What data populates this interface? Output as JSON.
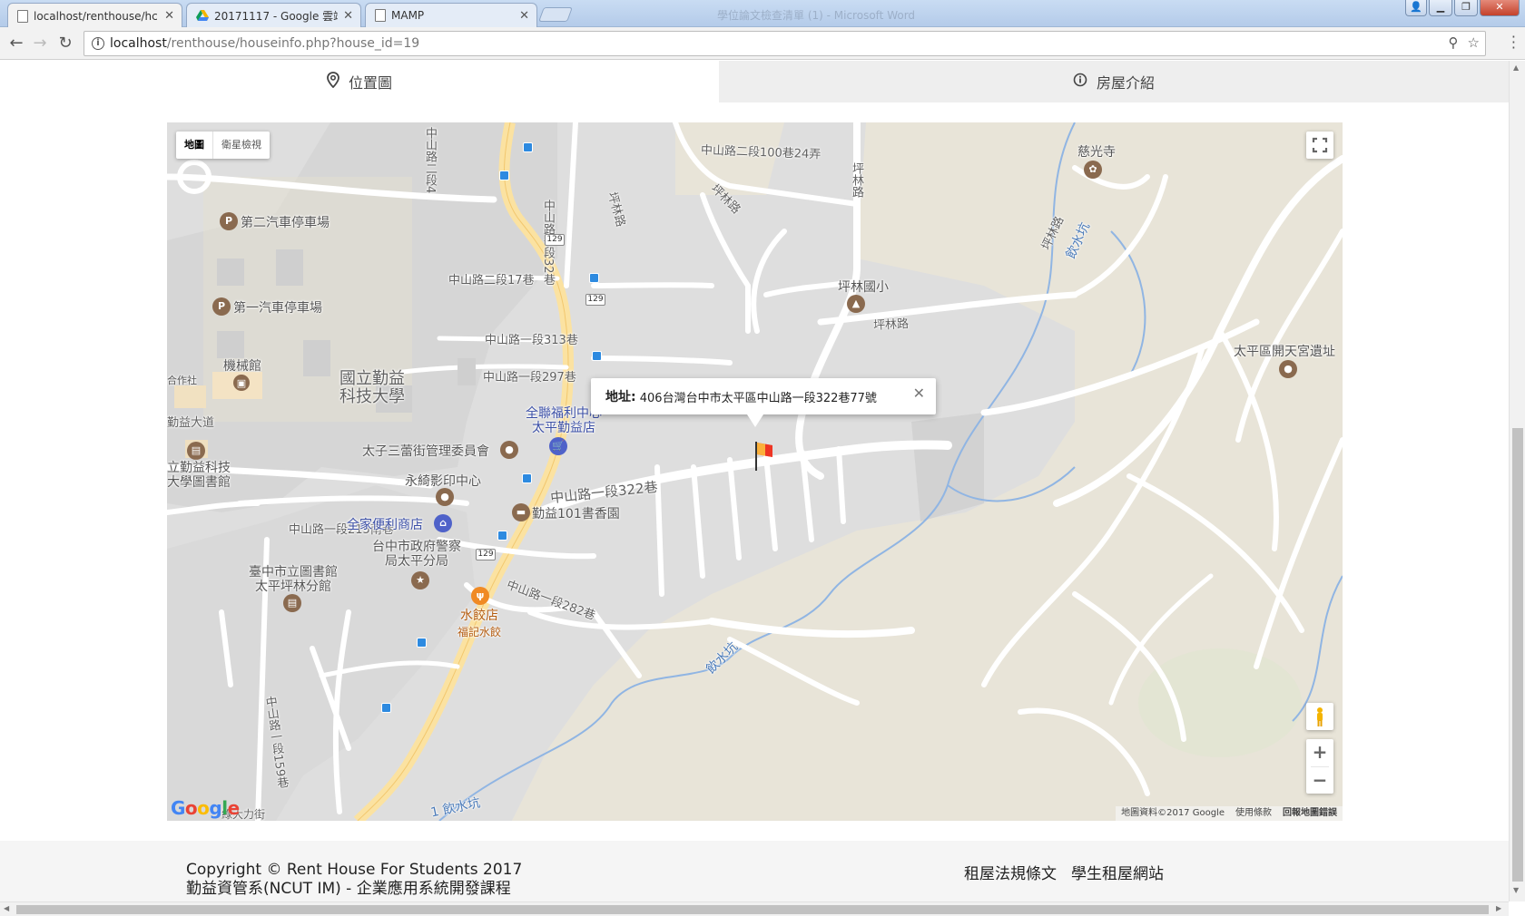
{
  "browser": {
    "tabs": [
      {
        "title": "localhost/renthouse/hc",
        "active": true
      },
      {
        "title": "20171117 - Google 雲端",
        "active": false
      },
      {
        "title": "MAMP",
        "active": false
      }
    ],
    "faded_window_title": "學位論文檢查清單 (1) - Microsoft Word",
    "url_host": "localhost",
    "url_path": "/renthouse/houseinfo.php?house_id=19"
  },
  "page_tabs": {
    "location": {
      "label": "位置圖",
      "icon": "map-pin-icon"
    },
    "intro": {
      "label": "房屋介紹",
      "icon": "info-circle-icon"
    }
  },
  "map": {
    "type_control": {
      "map": "地圖",
      "satellite": "衛星檢視"
    },
    "info_window": {
      "label": "地址:",
      "address": "406台灣台中市太平區中山路一段322巷77號"
    },
    "zoom_in": "+",
    "zoom_out": "−",
    "attribution": {
      "data": "地圖資料©2017 Google",
      "terms": "使用條款",
      "report": "回報地圖錯誤"
    },
    "logo": "Google",
    "labels": {
      "road_top": "中山路二段100巷24弄",
      "pinglin_v": "坪林路",
      "pinglin_h1": "坪林路",
      "pinglin_h2": "坪林路",
      "pinglin_a": "坪林路",
      "pinglin_b": "坪林路",
      "zs2_17": "中山路二段17巷",
      "zs1_313": "中山路一段313巷",
      "zs1_297": "中山路一段297巷",
      "zs1_322": "中山路一段322巷",
      "zs1_215": "中山路一段215南巷",
      "zs1_282": "中山路一段282巷",
      "zs1_32": "中山路一段32巷",
      "zs1_159": "中山路一段159巷",
      "zs2_4": "中山路二段4",
      "qinyi_ave": "勤益大道",
      "water_1": "飲水坑",
      "water_2": "飲水坑",
      "water_3": "1 飲水坑",
      "parking2": "第二汽車停車場",
      "parking1": "第一汽車停車場",
      "machine_hall": "機械館",
      "coop": "合作社",
      "ncut": "國立勤益\n科技大學",
      "ncut_lib": "立勤益科技\n大學圖書館",
      "pxmart": "全聯福利中心\n太平勤益店",
      "taizi": "太子三蕾街管理委員會",
      "yongqi": "永綺影印中心",
      "familymart": "全家便利商店",
      "bookstore": "勤益101書香園",
      "police": "台中市政府警察\n局太平分局",
      "library": "臺中市立圖書館\n太平坪林分館",
      "dumpling": "水餃店",
      "dumpling_sub": "福記水餃",
      "ciguang": "慈光寺",
      "pinglin_school": "坪林國小",
      "kaitian": "太平區開天宮遺址",
      "route_129": "129",
      "bottom_street": "綠大力街"
    }
  },
  "footer": {
    "copyright": "Copyright © Rent House For Students 2017",
    "course": "勤益資管系(NCUT IM) - 企業應用系統開發課程",
    "links": [
      "租屋法規條文",
      "學生租屋網站"
    ]
  }
}
